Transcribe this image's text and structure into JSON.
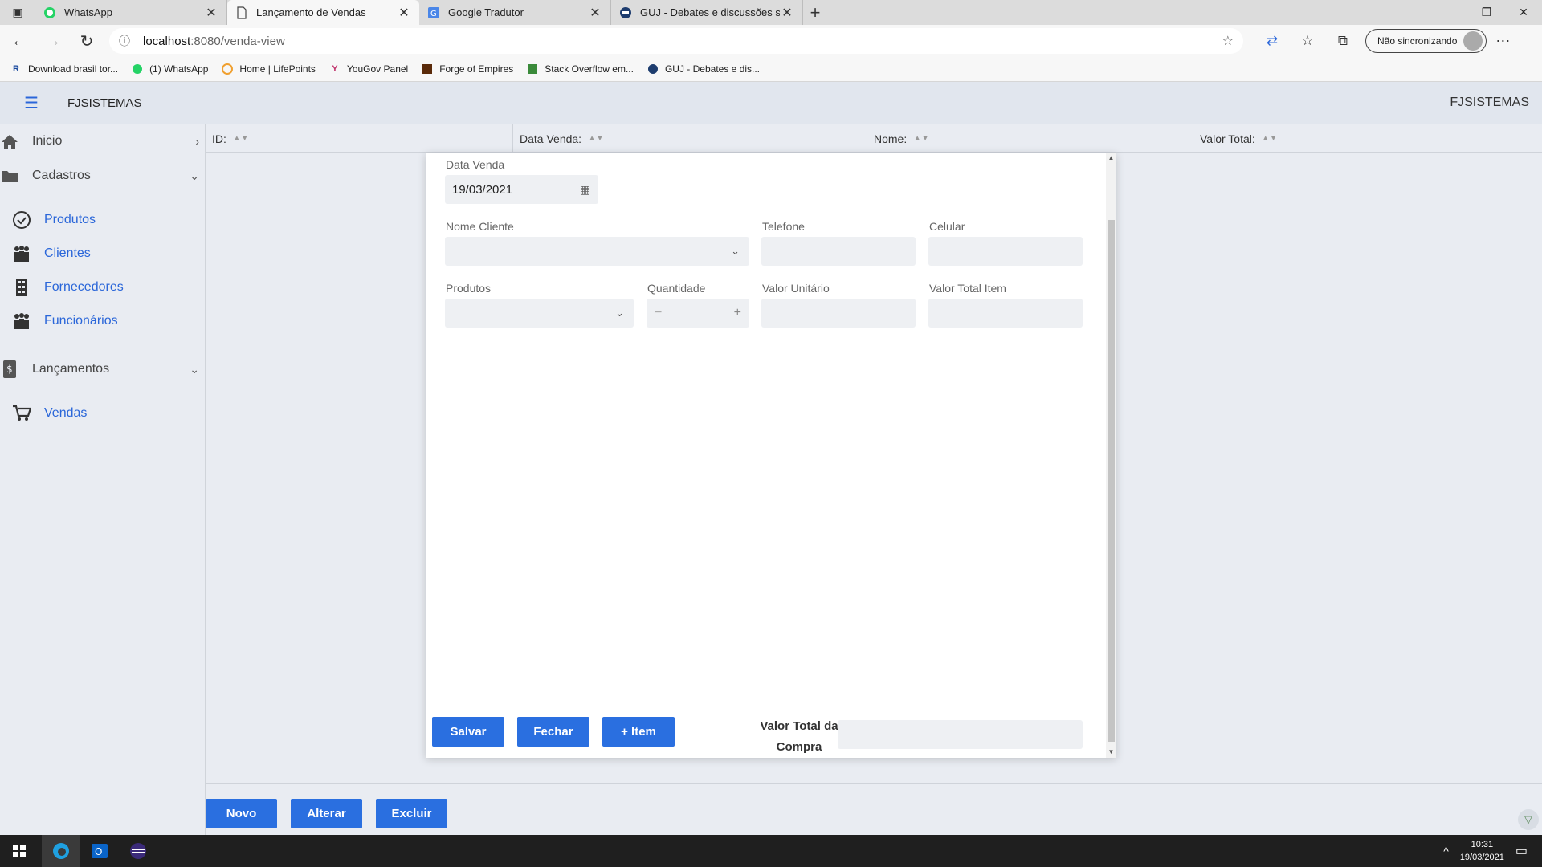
{
  "browser": {
    "tabs": [
      {
        "label": "WhatsApp",
        "icon": "whatsapp-icon"
      },
      {
        "label": "Lançamento de Vendas",
        "icon": "page-icon"
      },
      {
        "label": "Google Tradutor",
        "icon": "translate-icon"
      },
      {
        "label": "GUJ - Debates e discussões sobr",
        "icon": "guj-icon"
      }
    ],
    "url_host": "localhost",
    "url_path": ":8080/venda-view",
    "sync_label": "Não sincronizando",
    "bookmarks": [
      {
        "label": "Download brasil tor...",
        "icon": "r-icon"
      },
      {
        "label": "(1) WhatsApp",
        "icon": "whatsapp-icon"
      },
      {
        "label": "Home | LifePoints",
        "icon": "lifepoints-icon"
      },
      {
        "label": "YouGov Panel",
        "icon": "yougov-icon"
      },
      {
        "label": "Forge of Empires",
        "icon": "forge-icon"
      },
      {
        "label": "Stack Overflow em...",
        "icon": "stackoverflow-icon"
      },
      {
        "label": "GUJ - Debates e dis...",
        "icon": "guj-icon"
      }
    ]
  },
  "app": {
    "brand": "FJSISTEMAS",
    "brand_right": "FJSISTEMAS"
  },
  "sidebar": {
    "items": [
      {
        "label": "Inicio"
      },
      {
        "label": "Cadastros"
      },
      {
        "label": "Produtos"
      },
      {
        "label": "Clientes"
      },
      {
        "label": "Fornecedores"
      },
      {
        "label": "Funcionários"
      },
      {
        "label": "Lançamentos"
      },
      {
        "label": "Vendas"
      }
    ]
  },
  "table": {
    "columns": [
      "ID:",
      "Data Venda:",
      "Nome:",
      "Valor Total:"
    ]
  },
  "actions": {
    "novo": "Novo",
    "alterar": "Alterar",
    "excluir": "Excluir"
  },
  "modal": {
    "data_venda_label": "Data Venda",
    "data_venda_value": "19/03/2021",
    "nome_cliente_label": "Nome Cliente",
    "telefone_label": "Telefone",
    "celular_label": "Celular",
    "produtos_label": "Produtos",
    "quantidade_label": "Quantidade",
    "valor_unitario_label": "Valor Unitário",
    "valor_total_item_label": "Valor Total Item",
    "salvar": "Salvar",
    "fechar": "Fechar",
    "item": "+ Item",
    "valor_total_label_1": "Valor Total da",
    "valor_total_label_2": "Compra"
  },
  "taskbar": {
    "time": "10:31",
    "date": "19/03/2021"
  },
  "colors": {
    "accent": "#2a6fe0",
    "link": "#2a66d9"
  }
}
